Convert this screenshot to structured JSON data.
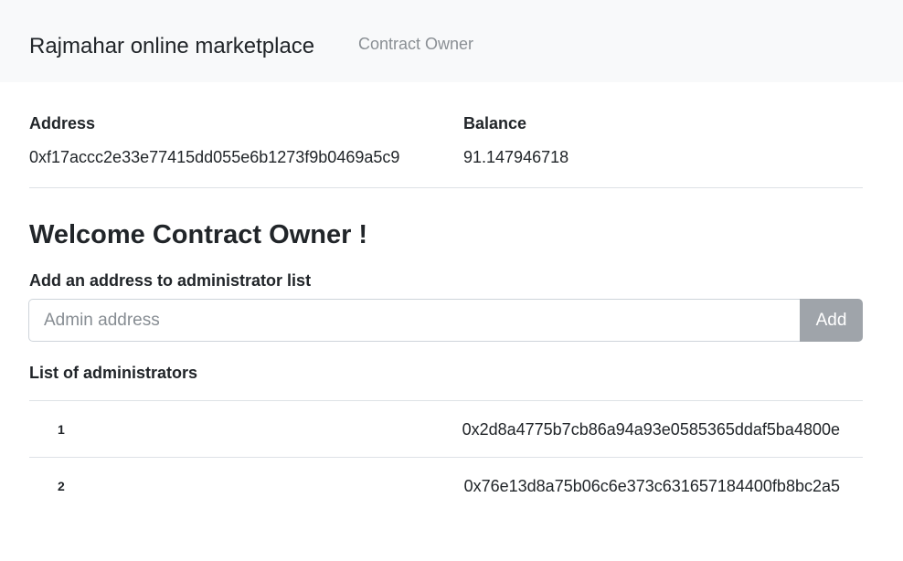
{
  "navbar": {
    "brand": "Rajmahar online marketplace",
    "link": "Contract Owner"
  },
  "account": {
    "address_label": "Address",
    "address_value": "0xf17accc2e33e77415dd055e6b1273f9b0469a5c9",
    "balance_label": "Balance",
    "balance_value": "91.147946718"
  },
  "main": {
    "welcome": "Welcome Contract Owner !",
    "add_label": "Add an address to administrator list",
    "input_placeholder": "Admin address",
    "input_value": "",
    "add_button": "Add",
    "list_label": "List of administrators",
    "administrators": [
      {
        "index": "1",
        "address": "0x2d8a4775b7cb86a94a93e0585365ddaf5ba4800e"
      },
      {
        "index": "2",
        "address": "0x76e13d8a75b06c6e373c631657184400fb8bc2a5"
      }
    ]
  }
}
